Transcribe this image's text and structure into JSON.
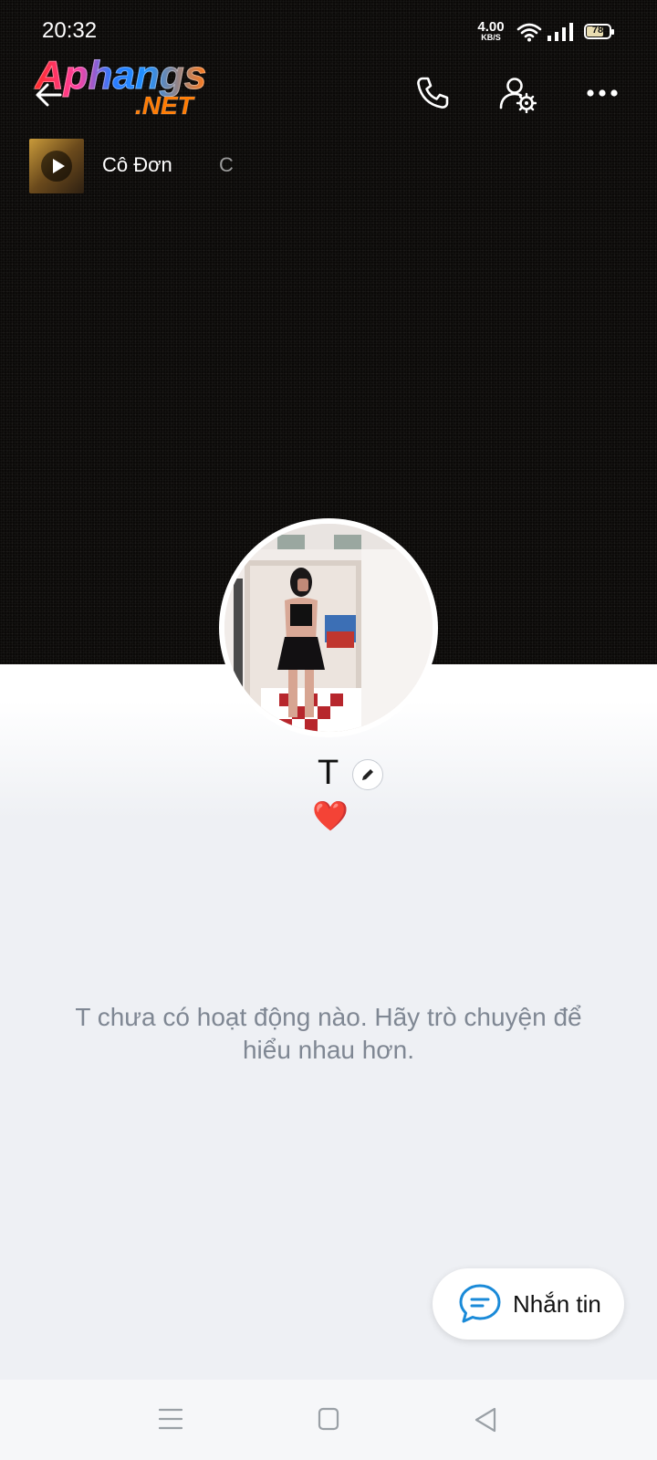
{
  "status_bar": {
    "time": "20:32",
    "net_speed_value": "4.00",
    "net_speed_unit": "KB/S",
    "battery": "78",
    "battery_level": 0.78
  },
  "watermark": {
    "logo_text": "Aphangs",
    "logo_sub": ".NET"
  },
  "header": {
    "back_icon": "arrow-left-icon",
    "call_icon": "phone-icon",
    "settings_icon": "user-gear-icon",
    "more_icon": "more-dots-icon"
  },
  "music": {
    "title": "Cô Đơn",
    "title_next": "C",
    "play_icon": "play-icon"
  },
  "profile": {
    "name": "T",
    "status_emoji": "❤️",
    "edit_icon": "pencil-icon"
  },
  "feed": {
    "empty_message": "T chưa có hoạt động nào. Hãy trò chuyện để hiểu nhau hơn."
  },
  "message_button": {
    "label": "Nhắn tin",
    "icon": "chat-bubble-icon"
  },
  "nav_bar": {
    "menu_icon": "menu-icon",
    "home_icon": "square-home-icon",
    "back_icon": "triangle-back-icon"
  },
  "colors": {
    "cover_bg": "#0b0908",
    "page_bg": "#eef0f4",
    "text_muted": "#7f8793",
    "accent_blue": "#1a8ad8",
    "heart_red": "#d51f2b"
  }
}
